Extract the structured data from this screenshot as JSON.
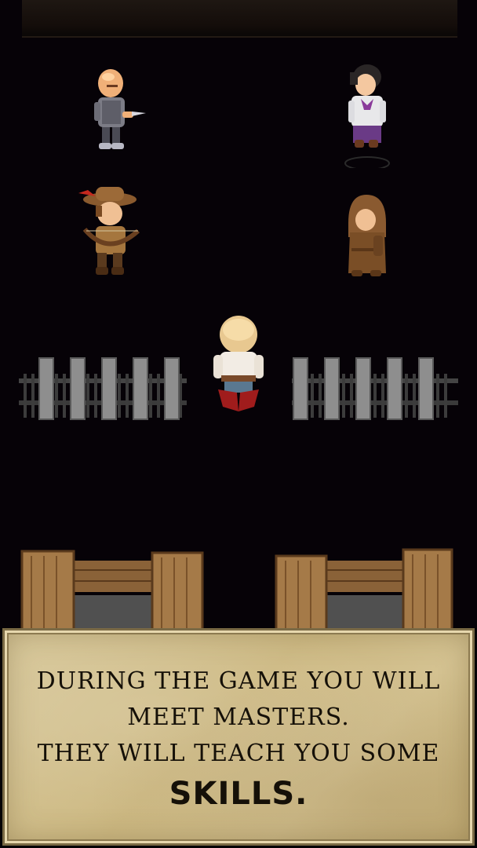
{
  "dialog": {
    "line1": "DURING THE GAME YOU WILL",
    "line2": "MEET MASTERS.",
    "line3": "THEY WILL TEACH YOU SOME",
    "line4": "SKILLS."
  },
  "scene": {
    "characters": [
      "bald-warrior",
      "noble-gentleman",
      "hunter-archer",
      "hooded-monk",
      "player-hero"
    ],
    "colors": {
      "background": "#060207",
      "parchment": "#d4c291",
      "text": "#151008"
    }
  }
}
